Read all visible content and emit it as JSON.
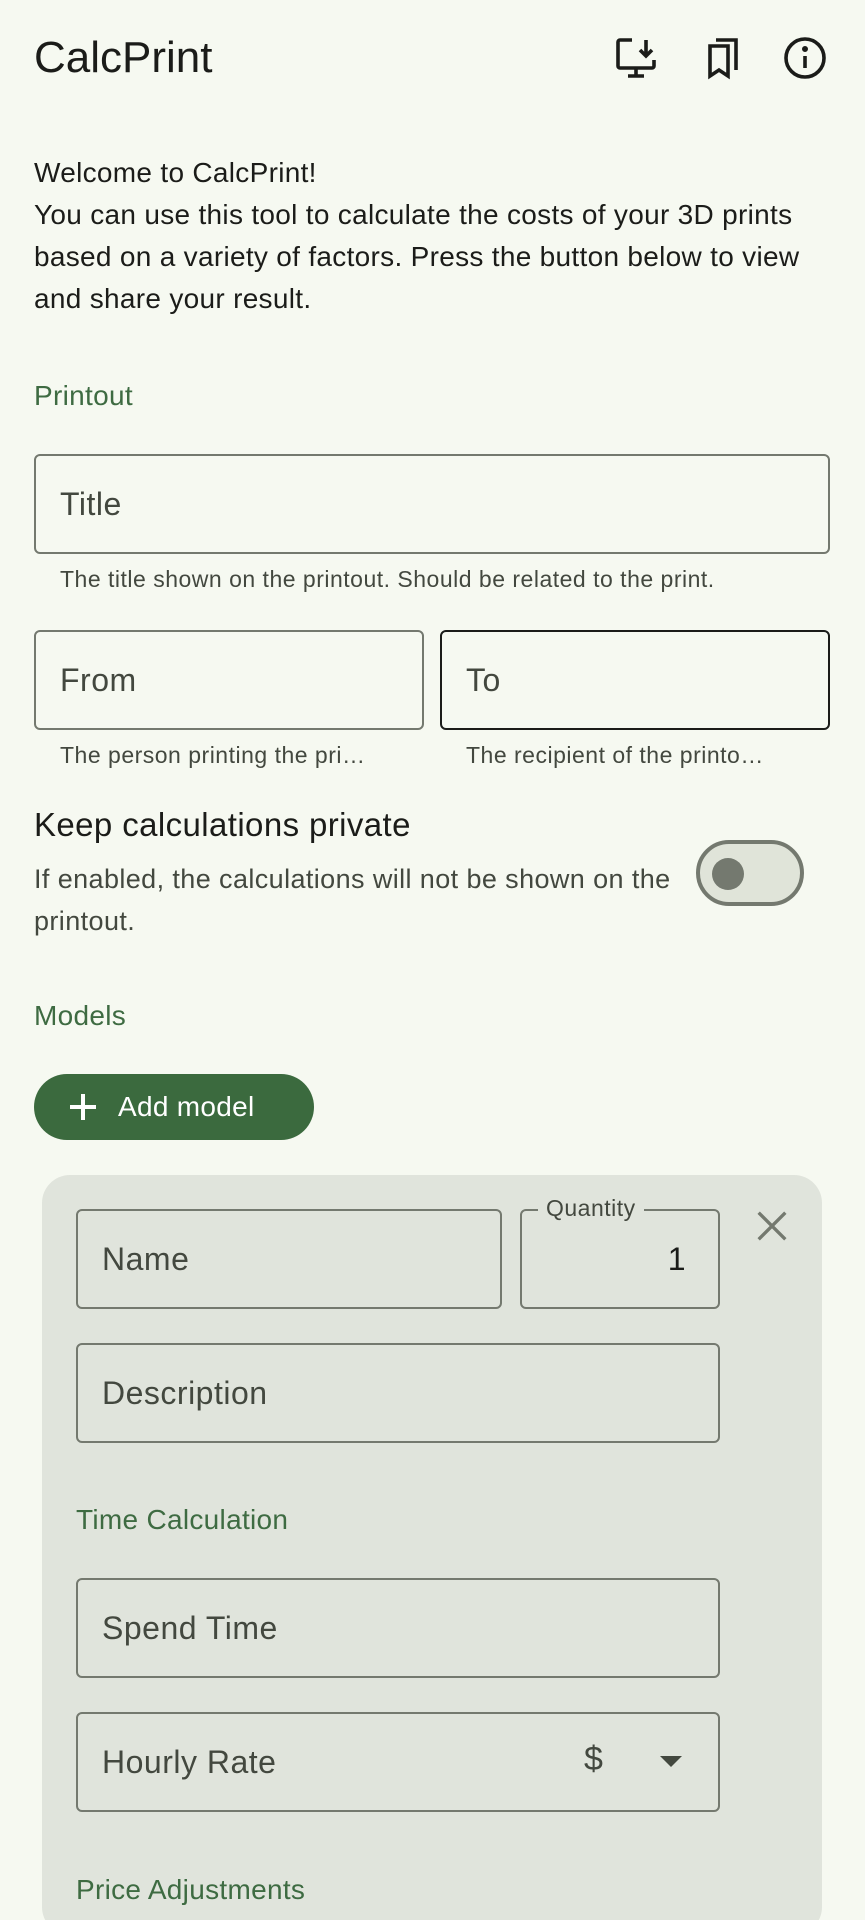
{
  "app": {
    "title": "CalcPrint"
  },
  "toolbar": {
    "icons": [
      "install-desktop-icon",
      "bookmarks-icon",
      "info-icon"
    ]
  },
  "intro": {
    "text": "Welcome to CalcPrint!\nYou can use this tool to calculate the costs of your 3D prints based on a variety of factors. Press the button below to view and share your result."
  },
  "printout": {
    "section_label": "Printout",
    "title_field": {
      "label": "Title",
      "helper": "The title shown on the printout. Should be related to the print."
    },
    "from_field": {
      "label": "From",
      "helper": "The person printing the pri…"
    },
    "to_field": {
      "label": "To",
      "helper": "The recipient of the printo…"
    },
    "private_setting": {
      "title": "Keep calculations private",
      "description": "If enabled, the calculations will not be shown on the printout.",
      "enabled": false
    }
  },
  "models": {
    "section_label": "Models",
    "add_button_label": "Add model",
    "model": {
      "name_label": "Name",
      "quantity_label": "Quantity",
      "quantity_value": "1",
      "description_label": "Description",
      "time_section_label": "Time Calculation",
      "spend_time_label": "Spend Time",
      "hourly_rate_label": "Hourly Rate",
      "currency_symbol": "$",
      "price_section_label": "Price Adjustments"
    }
  },
  "colors": {
    "accent": "#3b6a3e",
    "background": "#f6f9f1",
    "card": "#e0e4dc",
    "outline": "#74796f"
  }
}
